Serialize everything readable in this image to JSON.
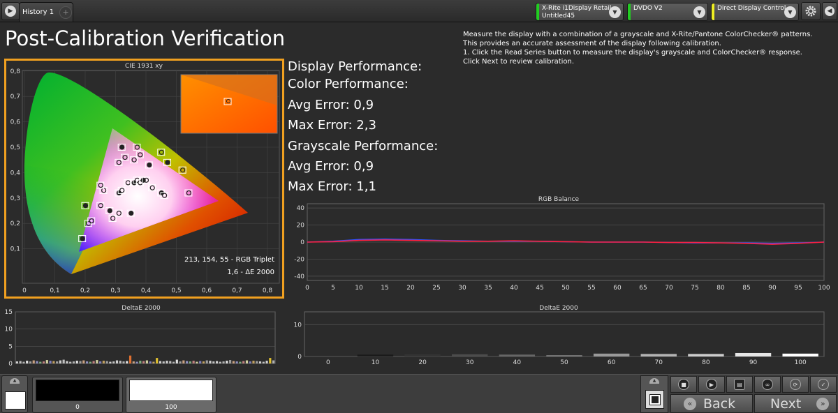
{
  "tabs": {
    "history_label": "History 1",
    "add_label": "+"
  },
  "toolbar": {
    "meter": {
      "line1": "X-Rite i1Display Retail",
      "line2": "Untitled45",
      "stripe": "#22cc22"
    },
    "pattern": {
      "line1": "DVDO V2",
      "stripe": "#22cc22"
    },
    "display": {
      "line1": "Direct Display Control",
      "stripe": "#eeee22"
    }
  },
  "page": {
    "title": "Post-Calibration Verification",
    "instructions": [
      "Measure the display with a combination of a grayscale and X-Rite/Pantone ColorChecker® patterns.",
      "This provides an accurate assessment of the display following calibration.",
      "1. Click the Read Series button to measure the display's grayscale and ColorChecker® response.",
      "Click Next to review calibration."
    ]
  },
  "performance": {
    "display_label": "Display Performance:",
    "color_label": "Color Performance:",
    "color_avg": "Avg Error: 0,9",
    "color_max": "Max Error: 2,3",
    "gray_label": "Grayscale Performance:",
    "gray_avg": "Avg Error: 0,9",
    "gray_max": "Max Error: 1,1"
  },
  "cie": {
    "title": "CIE 1931 xy",
    "rgb_triplet": "213, 154, 55 - RGB Triplet",
    "delta_e": "1,6 - ΔE 2000",
    "x_ticks": [
      "0",
      "0,1",
      "0,2",
      "0,3",
      "0,4",
      "0,5",
      "0,6",
      "0,7",
      "0,8"
    ],
    "y_ticks": [
      "0,1",
      "0,2",
      "0,3",
      "0,4",
      "0,5",
      "0,6",
      "0,7",
      "0,8"
    ]
  },
  "chart_data": [
    {
      "type": "line",
      "title": "RGB Balance",
      "x": [
        0,
        5,
        10,
        15,
        20,
        25,
        30,
        35,
        40,
        45,
        50,
        55,
        60,
        65,
        70,
        75,
        80,
        85,
        90,
        95,
        100
      ],
      "x_ticks": [
        "0",
        "5",
        "10",
        "15",
        "20",
        "25",
        "30",
        "35",
        "40",
        "45",
        "50",
        "55",
        "60",
        "65",
        "70",
        "75",
        "80",
        "85",
        "90",
        "95",
        "100"
      ],
      "y_ticks": [
        "40",
        "20",
        "0",
        "-20",
        "-40"
      ],
      "ylim": [
        -45,
        45
      ],
      "grid": true,
      "series": [
        {
          "color": "#3050ff",
          "values": [
            0,
            1,
            3,
            3.5,
            3,
            2,
            1.5,
            1,
            1,
            1,
            0.5,
            0,
            0,
            0,
            -0.5,
            -1,
            -1,
            -1,
            -1.5,
            -1,
            0
          ]
        },
        {
          "color": "#ff2040",
          "values": [
            0,
            0.5,
            2,
            2.5,
            2,
            1.5,
            1,
            1,
            1.5,
            1,
            0.5,
            0,
            0,
            0,
            -0.5,
            -0.5,
            -1,
            -1.5,
            -2.5,
            -1.5,
            0
          ]
        }
      ]
    },
    {
      "type": "bar",
      "title": "DeltaE 2000",
      "y_ticks": [
        "15",
        "10",
        "5",
        "0"
      ],
      "ylim": [
        0,
        15
      ],
      "values": [
        0.6,
        0.7,
        0.5,
        0.8,
        0.6,
        0.9,
        0.7,
        0.5,
        0.6,
        1.0,
        0.8,
        0.7,
        0.6,
        0.9,
        1.1,
        0.7,
        0.5,
        0.6,
        0.8,
        0.7,
        0.9,
        0.6,
        0.5,
        0.7,
        1.0,
        0.6,
        0.8,
        0.7,
        0.5,
        0.6,
        0.9,
        0.8,
        0.6,
        0.7,
        2.3,
        0.6,
        0.5,
        0.8,
        0.7,
        0.9,
        0.6,
        0.5,
        1.6,
        0.7,
        0.6,
        0.8,
        0.7,
        0.5,
        1.1,
        0.6,
        0.9,
        0.7,
        0.6,
        0.8,
        0.5,
        0.7,
        0.6,
        0.9,
        0.8,
        0.6,
        0.7,
        0.5,
        0.6,
        0.8,
        1.0,
        0.7,
        0.6,
        0.5,
        0.7,
        0.9,
        0.6,
        0.8,
        0.7,
        0.6,
        0.5,
        0.8,
        1.6,
        0.9
      ],
      "colors": [
        "#d0d0d0",
        "#c0c0c0",
        "#b0b0b0",
        "#e0e0e0",
        "#a0a0a0",
        "#c8a080",
        "#9090c0",
        "#80b080",
        "#c08080",
        "#d0d0a0",
        "#8080c0",
        "#c0a060",
        "#a0a0a0",
        "#d0d0d0",
        "#c0c0c0"
      ]
    },
    {
      "type": "bar",
      "title": "DeltaE 2000",
      "categories": [
        "0",
        "10",
        "20",
        "30",
        "40",
        "50",
        "60",
        "70",
        "80",
        "90",
        "100"
      ],
      "values": [
        0,
        0.6,
        0.7,
        0.7,
        0.6,
        0.4,
        0.9,
        0.8,
        0.8,
        1.1,
        0.9
      ],
      "y_ticks": [
        "10",
        "0"
      ],
      "ylim": [
        0,
        14
      ],
      "colors": [
        "#0a0a0a",
        "#1a1a1a",
        "#333333",
        "#4c4c4c",
        "#666666",
        "#808080",
        "#999999",
        "#b3b3b3",
        "#cccccc",
        "#e6e6e6",
        "#ffffff"
      ]
    }
  ],
  "bottom": {
    "swatch_black_label": "0",
    "swatch_white_label": "100",
    "back_label": "Back",
    "next_label": "Next"
  }
}
